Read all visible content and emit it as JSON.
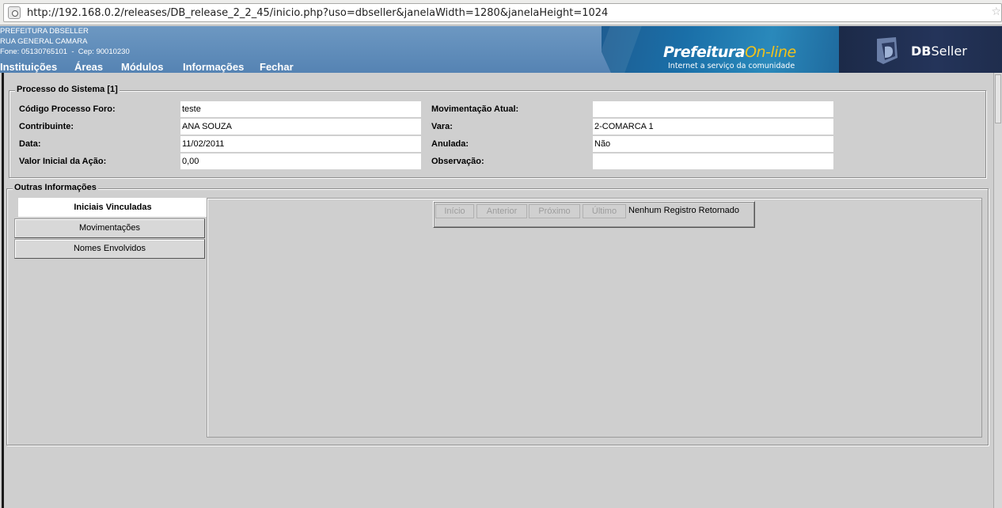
{
  "browser": {
    "url": "http://192.168.0.2/releases/DB_release_2_2_45/inicio.php?uso=dbseller&janelaWidth=1280&janelaHeight=1024"
  },
  "header": {
    "org_name": "PREFEITURA DBSELLER",
    "org_address": "RUA GENERAL CAMARA",
    "org_contact": "Fone: 05130765101  -  Cep: 90010230",
    "menu": [
      "Instituições",
      "Áreas",
      "Módulos",
      "Informações",
      "Fechar"
    ],
    "logo_prefeitura": "Prefeitura",
    "logo_online": "On-line",
    "logo_subtitle": "Internet a serviço da comunidade",
    "logo_db": "DB",
    "logo_seller": "Seller"
  },
  "processo": {
    "legend": "Processo do Sistema [1]",
    "fields": {
      "codigo_label": "Código Processo Foro:",
      "codigo_value": "teste",
      "contribuinte_label": "Contribuinte:",
      "contribuinte_value": "ANA SOUZA",
      "data_label": "Data:",
      "data_value": "11/02/2011",
      "valor_label": "Valor Inicial da Ação:",
      "valor_value": "0,00",
      "movimentacao_label": "Movimentação Atual:",
      "movimentacao_value": "",
      "vara_label": "Vara:",
      "vara_value": "2-COMARCA 1",
      "anulada_label": "Anulada:",
      "anulada_value": "Não",
      "observacao_label": "Observação:",
      "observacao_value": ""
    }
  },
  "outras": {
    "legend": "Outras Informações",
    "tabs": [
      "Iniciais Vinculadas",
      "Movimentações",
      "Nomes Envolvidos"
    ],
    "active_tab": "Iniciais Vinculadas",
    "nav": {
      "first": "Início",
      "prev": "Anterior",
      "next": "Próximo",
      "last": "Último",
      "message": "Nenhum Registro Retornado"
    }
  },
  "colors": {
    "banner": "#5f8cba",
    "background": "#cfcfcf",
    "logo_accent": "#f2c21b"
  }
}
